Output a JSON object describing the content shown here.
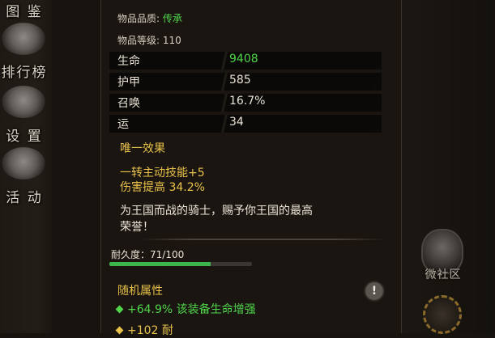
{
  "sidebar": {
    "items": [
      {
        "label": "图 鉴",
        "icon": "book-icon"
      },
      {
        "label": "排行榜",
        "icon": "ranking-icon"
      },
      {
        "label": "设 置",
        "icon": "gear-icon"
      },
      {
        "label": "活 动",
        "icon": "event-icon"
      }
    ]
  },
  "item": {
    "quality_label": "物品品质: ",
    "quality_value": "传承",
    "level_label": "物品等级: ",
    "level_value": "110",
    "stats": [
      {
        "name": "生命",
        "value": "9408",
        "highlight": true
      },
      {
        "name": "护甲",
        "value": "585",
        "highlight": false
      },
      {
        "name": "召唤",
        "value": "16.7%",
        "highlight": false
      },
      {
        "name": "运",
        "value": "34",
        "highlight": false
      }
    ],
    "unique_effect_title": "唯一效果",
    "unique_effects": [
      "一转主动技能+5",
      "伤害提高 34.2%"
    ],
    "flavor_lines": [
      "为王国而战的骑士，赐予你王国的最高",
      "荣誉！"
    ],
    "durability_label": "耐久度：71/100",
    "durability": {
      "current": 71,
      "max": 100
    },
    "random_attr_title": "随机属性",
    "random_attrs": [
      {
        "text": "+64.9% 该装备生命增强",
        "color": "green"
      },
      {
        "text": "+102 耐",
        "color": "gold"
      }
    ]
  },
  "rightbar": {
    "community_label": "微社区"
  },
  "colors": {
    "green": "#4fd64b",
    "gold": "#e9c24a",
    "panel_bg": "#1a1510"
  }
}
